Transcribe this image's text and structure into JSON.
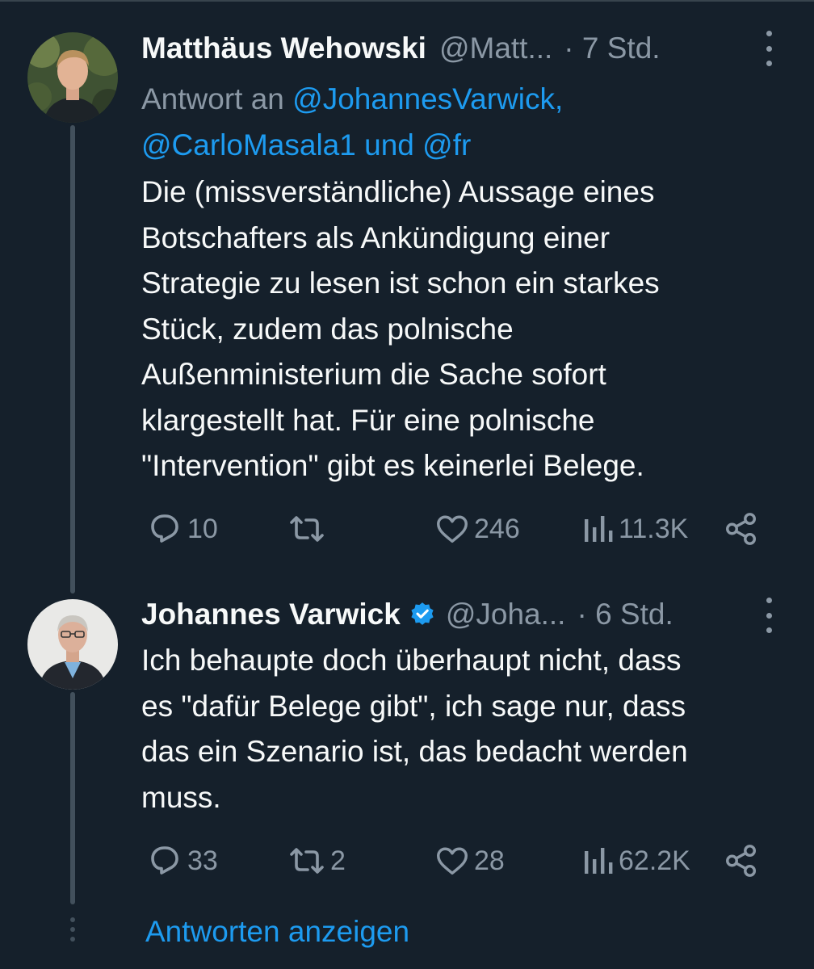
{
  "tweets": [
    {
      "name": "Matthäus Wehowski",
      "handle": "@Matt...",
      "time": "· 7 Std.",
      "verified": false,
      "reply_to_prefix": "Antwort an ",
      "reply_to_mention1": "@JohannesVarwick,",
      "reply_to_mention2": "@CarloMasala1",
      "reply_to_and": " und ",
      "reply_to_mention3": "@fr",
      "text_lines": [
        "Die (missverständliche) Aussage eines",
        "Botschafters als Ankündigung einer",
        "Strategie zu lesen ist schon ein starkes",
        "Stück, zudem das polnische",
        "Außenministerium die Sache sofort",
        "klargestellt hat. Für eine polnische",
        "\"Intervention\" gibt es keinerlei Belege."
      ],
      "replies": "10",
      "retweets": "",
      "likes": "246",
      "views": "11.3K",
      "icons": [
        "reply-icon",
        "retweet-icon",
        "like-icon",
        "views-icon",
        "share-icon"
      ]
    },
    {
      "name": "Johannes Varwick",
      "handle": "@Joha...",
      "time": "· 6 Std.",
      "verified": true,
      "text_lines": [
        "Ich behaupte doch überhaupt nicht, dass",
        "es \"dafür Belege gibt\", ich sage nur, dass",
        "das ein Szenario ist, das bedacht werden",
        "muss."
      ],
      "replies": "33",
      "retweets": "2",
      "likes": "28",
      "views": "62.2K",
      "icons": [
        "reply-icon",
        "retweet-icon",
        "like-icon",
        "views-icon",
        "share-icon"
      ]
    }
  ],
  "show_replies_label": "Antworten anzeigen",
  "colors": {
    "background": "#15202b",
    "text": "#f7f9f9",
    "muted": "#8b98a5",
    "accent": "#1d9bf0",
    "thread_line": "#42505c"
  }
}
